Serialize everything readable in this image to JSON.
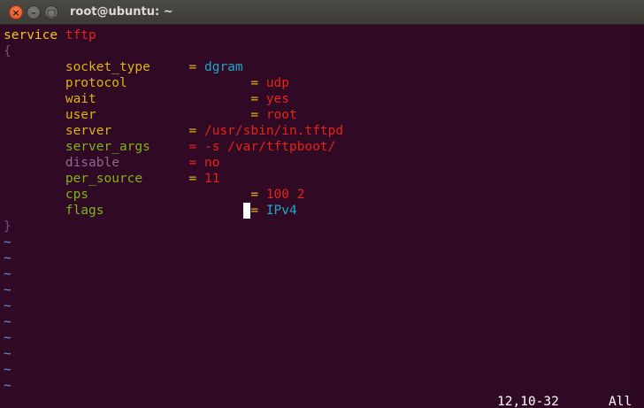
{
  "window": {
    "title": "root@ubuntu: ~",
    "controls": {
      "close_glyph": "×",
      "minimize_glyph": "–",
      "maximize_glyph": "□"
    }
  },
  "colors": {
    "background": "#300a24",
    "keyword": "#f2c21e",
    "brace": "#75507b",
    "key": "#ddb215",
    "red": "#e3241a",
    "cyan": "#1ea7c6",
    "green": "#7fb31c",
    "purple": "#8a6a8f",
    "tilde": "#6c89d4",
    "white": "#ffffff"
  },
  "editor": {
    "lines": [
      [
        {
          "text": "service ",
          "color": "keyword"
        },
        {
          "text": "tftp",
          "color": "red"
        }
      ],
      [
        {
          "text": "{",
          "color": "brace"
        }
      ],
      [
        {
          "text": "        socket_type     ",
          "color": "key"
        },
        {
          "text": "= ",
          "color": "key"
        },
        {
          "text": "dgram",
          "color": "cyan"
        }
      ],
      [
        {
          "text": "        protocol                ",
          "color": "key"
        },
        {
          "text": "= ",
          "color": "key"
        },
        {
          "text": "udp",
          "color": "red"
        }
      ],
      [
        {
          "text": "        wait                    ",
          "color": "key"
        },
        {
          "text": "= ",
          "color": "key"
        },
        {
          "text": "yes",
          "color": "red"
        }
      ],
      [
        {
          "text": "        user                    ",
          "color": "key"
        },
        {
          "text": "= ",
          "color": "key"
        },
        {
          "text": "root",
          "color": "red"
        }
      ],
      [
        {
          "text": "        server          ",
          "color": "key"
        },
        {
          "text": "= ",
          "color": "key"
        },
        {
          "text": "/usr/sbin/in.tftpd",
          "color": "red"
        }
      ],
      [
        {
          "text": "        server_args     ",
          "color": "green"
        },
        {
          "text": "= ",
          "color": "red"
        },
        {
          "text": "-s /var/tftpboot/",
          "color": "red"
        }
      ],
      [
        {
          "text": "        disable         ",
          "color": "purple"
        },
        {
          "text": "= ",
          "color": "red"
        },
        {
          "text": "no",
          "color": "red"
        }
      ],
      [
        {
          "text": "        per_source      ",
          "color": "green"
        },
        {
          "text": "= ",
          "color": "key"
        },
        {
          "text": "11",
          "color": "red"
        }
      ],
      [
        {
          "text": "        cps                     ",
          "color": "green"
        },
        {
          "text": "= ",
          "color": "key"
        },
        {
          "text": "100 2",
          "color": "red"
        }
      ],
      [
        {
          "text": "        flags                  ",
          "color": "green"
        },
        {
          "text": " ",
          "cursor": true
        },
        {
          "text": "= ",
          "color": "key"
        },
        {
          "text": "IPv4",
          "color": "cyan"
        }
      ],
      [
        {
          "text": "}",
          "color": "brace"
        }
      ],
      [
        {
          "text": "~",
          "color": "tilde"
        }
      ],
      [
        {
          "text": "~",
          "color": "tilde"
        }
      ],
      [
        {
          "text": "~",
          "color": "tilde"
        }
      ],
      [
        {
          "text": "~",
          "color": "tilde"
        }
      ],
      [
        {
          "text": "~",
          "color": "tilde"
        }
      ],
      [
        {
          "text": "~",
          "color": "tilde"
        }
      ],
      [
        {
          "text": "~",
          "color": "tilde"
        }
      ],
      [
        {
          "text": "~",
          "color": "tilde"
        }
      ],
      [
        {
          "text": "~",
          "color": "tilde"
        }
      ],
      [
        {
          "text": "~",
          "color": "tilde"
        }
      ]
    ]
  },
  "status": {
    "position": "12,10-32",
    "scroll": "All"
  }
}
